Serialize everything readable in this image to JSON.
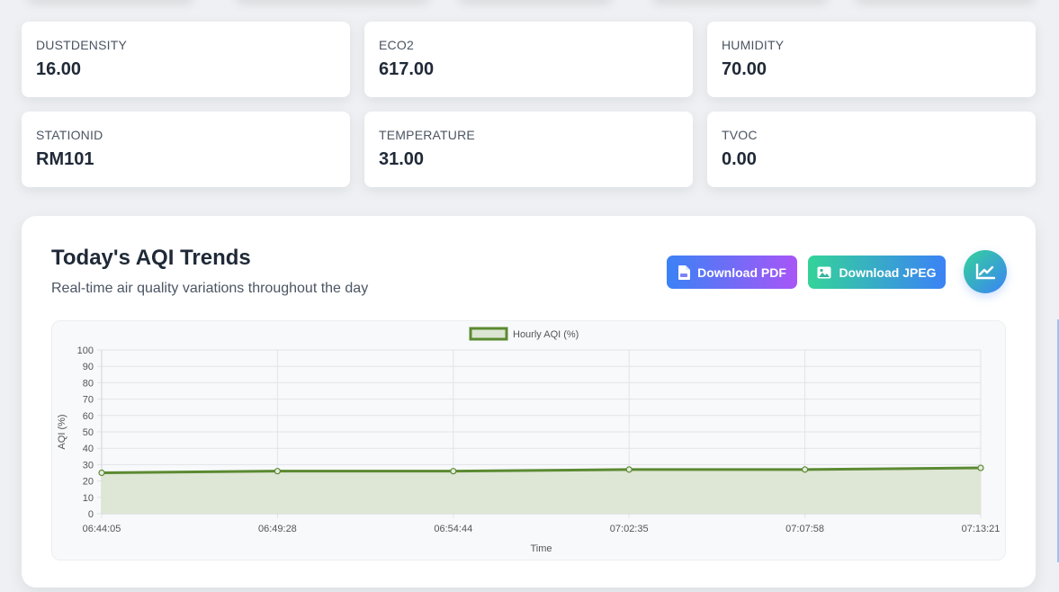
{
  "stats": [
    {
      "label": "DUSTDENSITY",
      "value": "16.00"
    },
    {
      "label": "ECO2",
      "value": "617.00"
    },
    {
      "label": "HUMIDITY",
      "value": "70.00"
    },
    {
      "label": "STATIONID",
      "value": "RM101"
    },
    {
      "label": "TEMPERATURE",
      "value": "31.00"
    },
    {
      "label": "TVOC",
      "value": "0.00"
    }
  ],
  "trends": {
    "title": "Today's AQI Trends",
    "subtitle": "Real-time air quality variations throughout the day",
    "download_pdf_label": "Download PDF",
    "download_jpeg_label": "Download JPEG"
  },
  "chart_data": {
    "type": "line",
    "x": [
      "06:44:05",
      "06:49:28",
      "06:54:44",
      "07:02:35",
      "07:07:58",
      "07:13:21"
    ],
    "series": [
      {
        "name": "Hourly AQI (%)",
        "values": [
          25,
          26,
          26,
          27,
          27,
          28
        ]
      }
    ],
    "xlabel": "Time",
    "ylabel": "AQI (%)",
    "ylim": [
      0,
      100
    ],
    "yticks": [
      "0",
      "10",
      "20",
      "30",
      "40",
      "50",
      "60",
      "70",
      "80",
      "90",
      "100"
    ],
    "grid": true,
    "legend": "top-center",
    "fill": true,
    "line_color": "#5b8a32",
    "fill_color": "#dce5d3"
  },
  "colors": {
    "pdf_gradient": [
      "#3b82f6",
      "#a855f7"
    ],
    "jpeg_gradient": [
      "#34d399",
      "#3b82f6"
    ]
  }
}
